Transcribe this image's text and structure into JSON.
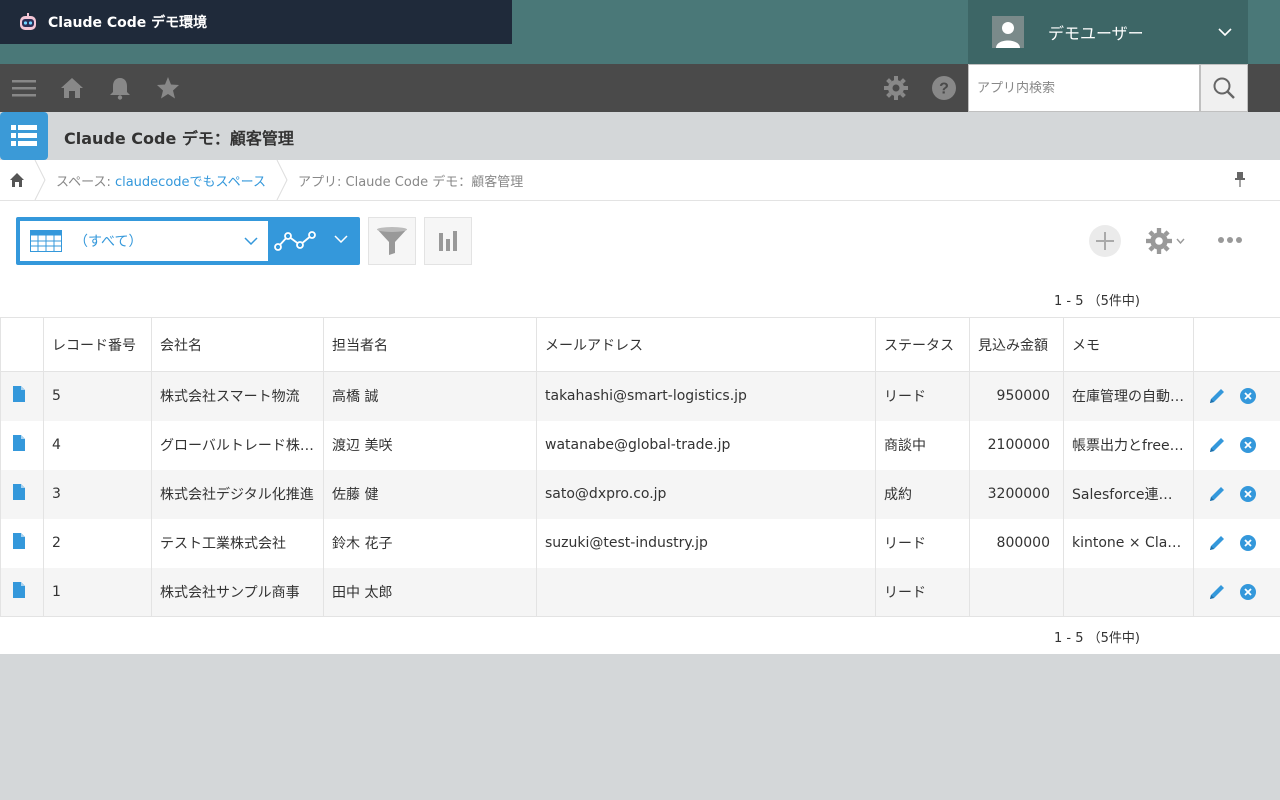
{
  "header": {
    "brand_title": "Claude Code デモ環境",
    "user_name": "デモユーザー"
  },
  "toolbar": {
    "search_placeholder": "アプリ内検索"
  },
  "app": {
    "title": "Claude Code デモ：顧客管理"
  },
  "breadcrumb": {
    "space_prefix": "スペース: ",
    "space_name": "claudecodeでもスペース",
    "app_label": "アプリ: Claude Code デモ：顧客管理"
  },
  "view": {
    "selected": "（すべて）"
  },
  "pager": {
    "text": "1 - 5 （5件中)"
  },
  "table": {
    "columns": [
      "レコード番号",
      "会社名",
      "担当者名",
      "メールアドレス",
      "ステータス",
      "見込み金額",
      "メモ"
    ],
    "rows": [
      {
        "id": "5",
        "company": "株式会社スマート物流",
        "person": "高橋 誠",
        "email": "takahashi@smart-logistics.jp",
        "status": "リード",
        "amount": "950000",
        "memo": "在庫管理の自動…"
      },
      {
        "id": "4",
        "company": "グローバルトレード株…",
        "person": "渡辺 美咲",
        "email": "watanabe@global-trade.jp",
        "status": "商談中",
        "amount": "2100000",
        "memo": "帳票出力とfree…"
      },
      {
        "id": "3",
        "company": "株式会社デジタル化推進",
        "person": "佐藤 健",
        "email": "sato@dxpro.co.jp",
        "status": "成約",
        "amount": "3200000",
        "memo": "Salesforce連携…"
      },
      {
        "id": "2",
        "company": "テスト工業株式会社",
        "person": "鈴木 花子",
        "email": "suzuki@test-industry.jp",
        "status": "リード",
        "amount": "800000",
        "memo": "kintone × Clau…"
      },
      {
        "id": "1",
        "company": "株式会社サンプル商事",
        "person": "田中 太郎",
        "email": "",
        "status": "リード",
        "amount": "",
        "memo": ""
      }
    ]
  },
  "colors": {
    "accent": "#3498db",
    "header_bg": "#4a7878",
    "brand_bg": "#1f2a3a",
    "toolbar_bg": "#4a4a4a"
  }
}
